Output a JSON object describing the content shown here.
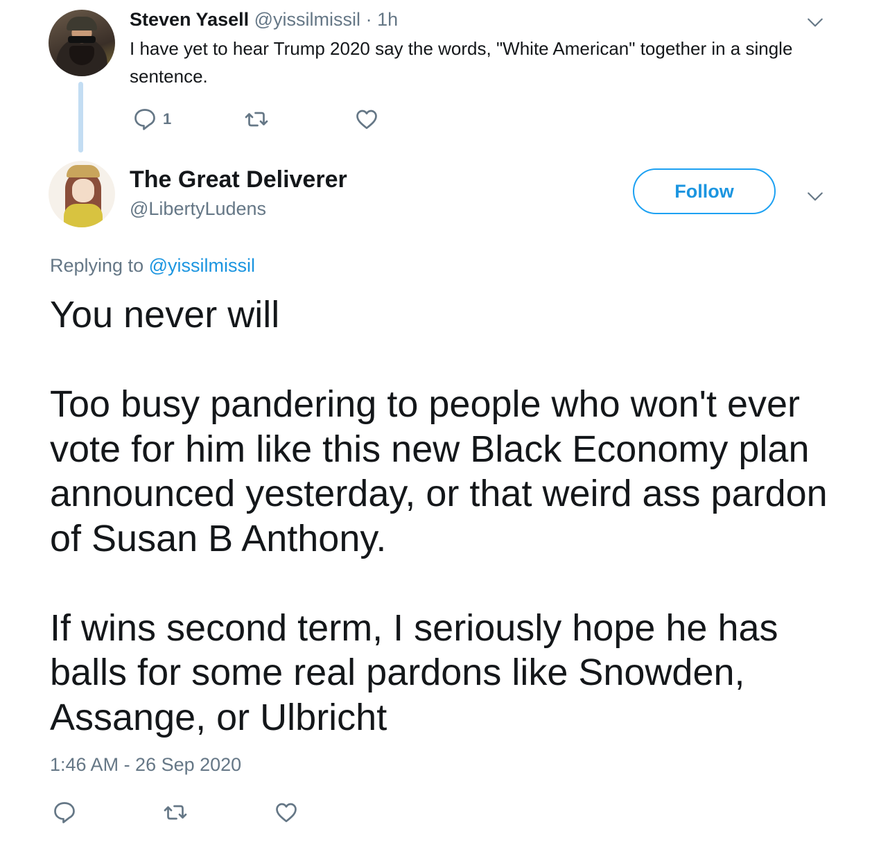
{
  "parent_tweet": {
    "author_name": "Steven Yasell",
    "handle": "@yissilmissil",
    "time_sep": "·",
    "time": "1h",
    "text": "I have yet to hear Trump 2020 say the words, \"White American\" together in a single sentence.",
    "reply_count": "1",
    "avatar_icon": "user-avatar",
    "menu_icon": "chevron-down-icon"
  },
  "reply_tweet": {
    "author_name": "The Great Deliverer",
    "handle": "@LibertyLudens",
    "follow_label": "Follow",
    "replying_prefix": "Replying to",
    "replying_mention": "@yissilmissil",
    "paragraphs": [
      "You never will",
      "Too busy pandering to people who won't ever vote for him like this new Black Economy plan announced yesterday, or that weird ass pardon of Susan B Anthony.",
      "If wins second term, I seriously hope he has balls for some real pardons like Snowden, Assange, or Ulbricht"
    ],
    "timestamp": "1:46 AM - 26 Sep 2020"
  },
  "colors": {
    "text_primary": "#14171a",
    "text_secondary": "#657786",
    "accent": "#1da1f2",
    "thread_line": "#c3ddf3"
  }
}
